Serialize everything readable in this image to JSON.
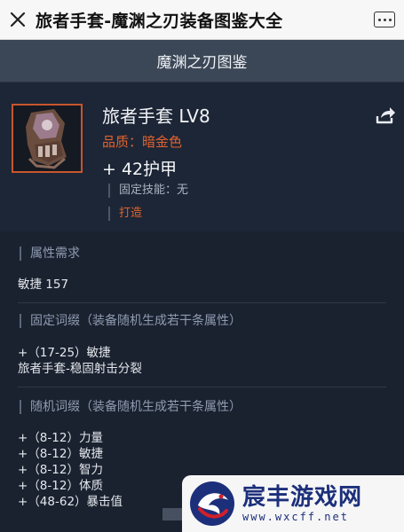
{
  "topbar": {
    "title": "旅者手套-魔渊之刃装备图鉴大全"
  },
  "header": {
    "title": "魔渊之刃图鉴"
  },
  "item": {
    "name": "旅者手套 LV8",
    "quality": "品质：暗金色",
    "armor": "+ 42护甲",
    "fixed_skill": "固定技能：无",
    "forge": "打造"
  },
  "sections": {
    "requirement": {
      "title": "属性需求",
      "lines": [
        "敏捷 157"
      ]
    },
    "fixed_affix": {
      "title": "固定词缀（装备随机生成若干条属性）",
      "lines": [
        "+（17-25）敏捷",
        "旅者手套-稳固射击分裂"
      ]
    },
    "random_affix": {
      "title": "随机词缀（装备随机生成若干条属性）",
      "lines": [
        "+（8-12）力量",
        "+（8-12）敏捷",
        "+（8-12）智力",
        "+（8-12）体质",
        "+（48-62）暴击值"
      ]
    }
  },
  "watermark": {
    "name": "宸丰游戏网",
    "url": "www.wxcff.net"
  },
  "colors": {
    "accent": "#e0622e",
    "background": "#1a2230",
    "header": "#3b4656"
  },
  "icons": {
    "close": "close-icon",
    "more": "more-icon",
    "share": "share-icon"
  }
}
